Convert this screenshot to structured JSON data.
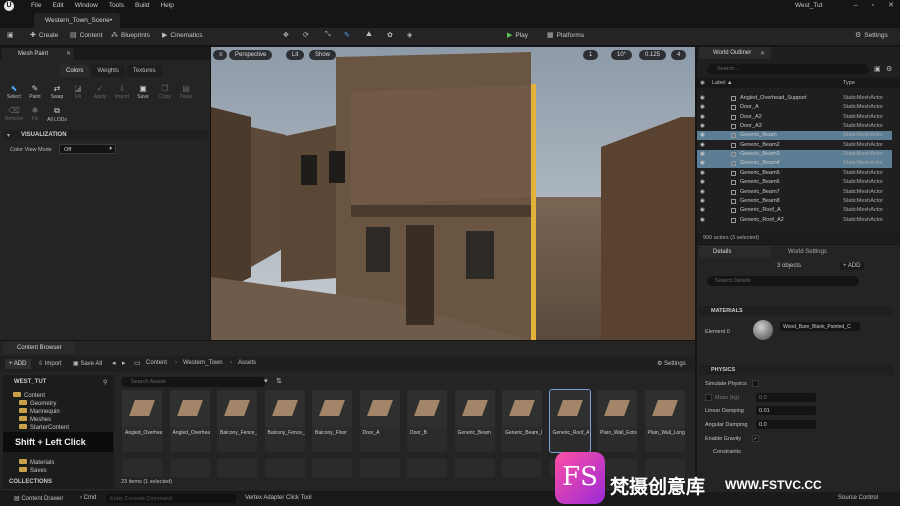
{
  "app": {
    "logo": "U",
    "menus": [
      "File",
      "Edit",
      "Window",
      "Tools",
      "Build",
      "Help"
    ],
    "project": "West_Tut",
    "scene_tab": "Western_Town_Scene•"
  },
  "toolbar": {
    "create": "Create",
    "content": "Content",
    "blueprints": "Blueprints",
    "cinematics": "Cinematics",
    "play": "Play",
    "platforms": "Platforms",
    "settings": "Settings"
  },
  "mesh_paint": {
    "tab": "Mesh Paint",
    "modes": [
      "Colors",
      "Weights",
      "Textures"
    ],
    "active_mode": "Colors",
    "tools": [
      "Select",
      "Paint",
      "Swap",
      "Fill",
      "Apply",
      "Import",
      "Save",
      "Copy",
      "Paste",
      "Remove",
      "Fix",
      "All LODs"
    ],
    "section": "VISUALIZATION",
    "color_view_label": "Color View Mode",
    "color_view_value": "Off"
  },
  "viewport": {
    "perspective": "Perspective",
    "lit": "Lit",
    "show": "Show",
    "angle": "10°",
    "scale": "0.125",
    "cam": "4",
    "grid": "10",
    "snap": "1"
  },
  "outliner": {
    "tab": "World Outliner",
    "search_placeholder": "Search...",
    "col_label": "Label ▲",
    "col_type": "Type",
    "rows": [
      {
        "name": "Angled_Overhead_Support",
        "type": "StaticMeshActor",
        "sel": false
      },
      {
        "name": "Door_A",
        "type": "StaticMeshActor",
        "sel": false
      },
      {
        "name": "Door_A2",
        "type": "StaticMeshActor",
        "sel": false
      },
      {
        "name": "Door_A3",
        "type": "StaticMeshActor",
        "sel": false
      },
      {
        "name": "Generic_Beam",
        "type": "StaticMeshActor",
        "sel": true
      },
      {
        "name": "Generic_Beam2",
        "type": "StaticMeshActor",
        "sel": false
      },
      {
        "name": "Generic_Beam3",
        "type": "StaticMeshActor",
        "sel": true
      },
      {
        "name": "Generic_Beam4",
        "type": "StaticMeshActor",
        "sel": true
      },
      {
        "name": "Generic_Beam5",
        "type": "StaticMeshActor",
        "sel": false
      },
      {
        "name": "Generic_Beam6",
        "type": "StaticMeshActor",
        "sel": false
      },
      {
        "name": "Generic_Beam7",
        "type": "StaticMeshActor",
        "sel": false
      },
      {
        "name": "Generic_Beam8",
        "type": "StaticMeshActor",
        "sel": false
      },
      {
        "name": "Generic_Roof_A",
        "type": "StaticMeshActor",
        "sel": false
      },
      {
        "name": "Generic_Roof_A2",
        "type": "StaticMeshActor",
        "sel": false
      }
    ],
    "status": "900 actors (3 selected)"
  },
  "details": {
    "tab": "Details",
    "tab2": "World Settings",
    "objects": "3 objects",
    "add": "+ ADD",
    "search_placeholder": "Search Details",
    "materials_section": "MATERIALS",
    "element": "Element 0",
    "material": "Wood_Bare_Blank_Painted_C",
    "physics_section": "PHYSICS",
    "simulate_physics": "Simulate Physics",
    "mass": "Mass (kg)",
    "mass_value": "0.0",
    "linear_damping": "Linear Damping",
    "linear_damping_value": "0.01",
    "angular_damping": "Angular Damping",
    "angular_damping_value": "0.0",
    "enable_gravity": "Enable Gravity",
    "constraints": "Constraints"
  },
  "content_browser": {
    "tab": "Content Browser",
    "add": "+ ADD",
    "import": "Import",
    "save_all": "Save All",
    "path": [
      "Content",
      "Western_Town",
      "Assets"
    ],
    "settings": "Settings",
    "root": "WEST_TUT",
    "search_placeholder": "Search Assets",
    "tree": [
      "Content",
      "Geometry",
      "Mannequin",
      "Meshes",
      "StarterContent",
      "Materials",
      "Saves"
    ],
    "collections": "COLLECTIONS",
    "status": "23 items (1 selected)",
    "assets": [
      "Angled_Overhead_Version",
      "Angled_Overhead_Support",
      "Balcony_Fence_Beam",
      "Balcony_Fence_Straight",
      "Balcony_Floor",
      "Door_A",
      "Door_B",
      "Generic_Beam",
      "Generic_Beam_B",
      "Generic_Roof_A",
      "Plain_Wall_Extra_Short",
      "Plain_Wall_Long"
    ],
    "selected_asset": "Generic_Roof_A"
  },
  "tooltip": "Shift + Left Click",
  "statusbar": {
    "drawer": "Content Drawer",
    "cmd": "Cmd",
    "console_placeholder": "Enter Console Command",
    "vertex": "Vertex Adapter Click Tool",
    "source": "Source Control"
  },
  "watermark": {
    "logo": "FS",
    "text": "梵摄创意库",
    "url": "WWW.FSTVC.CC"
  }
}
